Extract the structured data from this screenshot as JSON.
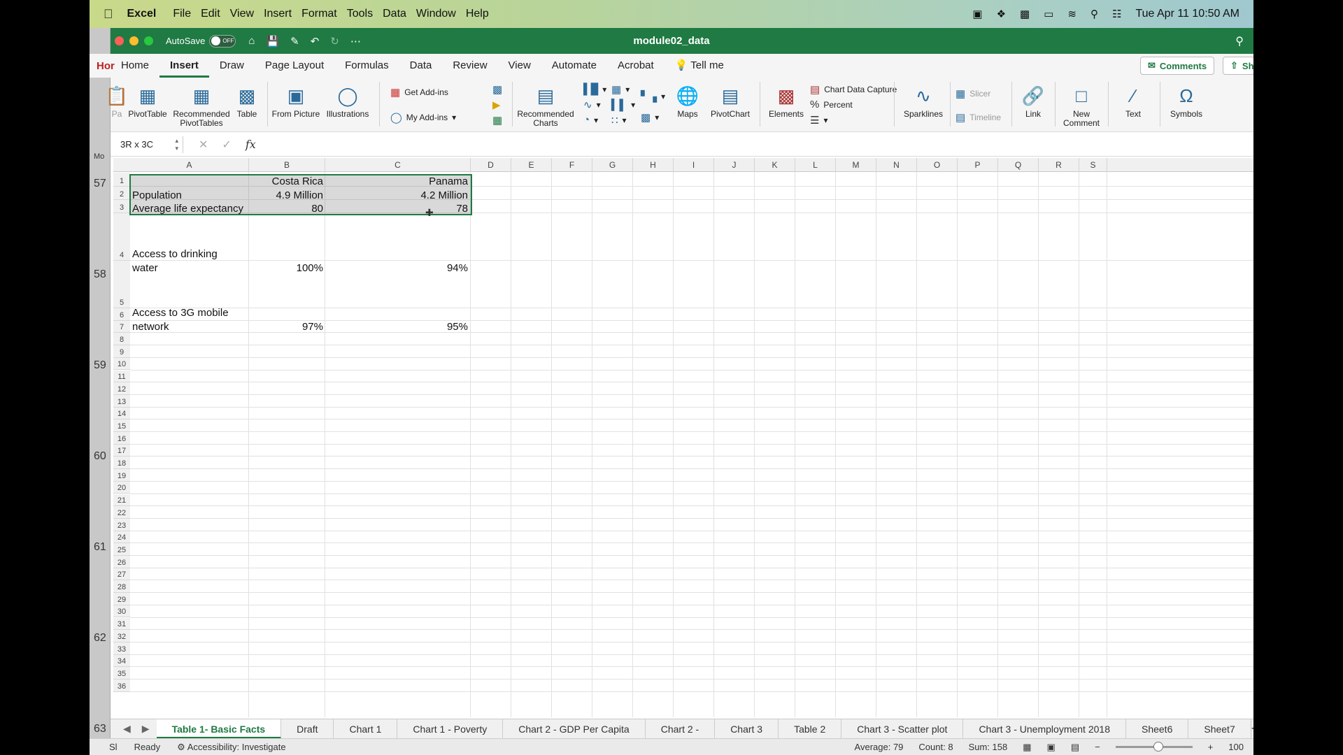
{
  "menubar": {
    "app": "Excel",
    "items": [
      "File",
      "Edit",
      "View",
      "Insert",
      "Format",
      "Tools",
      "Data",
      "Window",
      "Help"
    ],
    "datetime": "Tue Apr 11  10:50 AM"
  },
  "titlebar": {
    "autosave_label": "AutoSave",
    "autosave_state": "OFF",
    "document": "module02_data"
  },
  "ribbon_tabs": {
    "partial": "Hor",
    "items": [
      "Home",
      "Insert",
      "Draw",
      "Page Layout",
      "Formulas",
      "Data",
      "Review",
      "View",
      "Automate",
      "Acrobat"
    ],
    "active": "Insert",
    "tell_me": "Tell me",
    "comments": "Comments",
    "share_partial": "Sh"
  },
  "ribbon": {
    "paste_partial": "Pa",
    "pivot_table": "PivotTable",
    "recommended_pivot": "Recommended PivotTables",
    "table": "Table",
    "from_picture": "From Picture",
    "illustrations": "Illustrations",
    "get_addins": "Get Add-ins",
    "my_addins": "My Add-ins",
    "recommended_charts": "Recommended Charts",
    "maps": "Maps",
    "pivot_chart": "PivotChart",
    "elements": "Elements",
    "chart_data_capture": "Chart Data Capture",
    "percent": "Percent",
    "sparklines": "Sparklines",
    "slicer": "Slicer",
    "timeline": "Timeline",
    "link": "Link",
    "new_comment": "New Comment",
    "text": "Text",
    "symbols": "Symbols"
  },
  "formula_bar": {
    "name_box": "3R x 3C",
    "fx": "fx",
    "content": ""
  },
  "outer_rows": [
    "57",
    "58",
    "59",
    "60",
    "61",
    "62",
    "63"
  ],
  "outer_label_mo": "Mo",
  "columns": [
    "A",
    "B",
    "C",
    "D",
    "E",
    "F",
    "G",
    "H",
    "I",
    "J",
    "K",
    "L",
    "M",
    "N",
    "O",
    "P",
    "Q",
    "R",
    "S"
  ],
  "rows": [
    "1",
    "2",
    "3",
    "4",
    "5",
    "6",
    "7",
    "8",
    "9",
    "10",
    "11",
    "12",
    "13",
    "14",
    "15",
    "16",
    "17",
    "18",
    "19",
    "20",
    "21",
    "22",
    "23",
    "24",
    "25",
    "26",
    "27",
    "28",
    "29",
    "30",
    "31",
    "32",
    "33",
    "34",
    "35",
    "36"
  ],
  "cells": {
    "B1": "Costa Rica",
    "C1": "Panama",
    "A2": "Population",
    "B2": "4.9 Million",
    "C2": "4.2 Million",
    "A3": "Average life expectancy",
    "B3": "80",
    "C3": "78",
    "A4_line1": "Access to drinking",
    "A4_line2": "water",
    "B4": "100%",
    "C4": "94%",
    "A5_line1": "Access to 3G mobile",
    "A5_line2": "network",
    "B5": "97%",
    "C5": "95%"
  },
  "sheet_tabs": [
    "Table 1- Basic Facts",
    "Draft",
    "Chart 1",
    "Chart 1 - Poverty",
    "Chart 2 - GDP Per Capita",
    "Chart 2 -",
    "Chart 3",
    "Table 2",
    "Chart 3 - Scatter plot",
    "Chart 3 - Unemployment 2018",
    "Sheet6",
    "Sheet7"
  ],
  "active_sheet": "Table 1- Basic Facts",
  "status": {
    "partial": "Sl",
    "ready": "Ready",
    "accessibility": "Accessibility: Investigate",
    "average": "Average: 79",
    "count": "Count: 8",
    "sum": "Sum: 158",
    "zoom": "100"
  },
  "colors": {
    "excel_green": "#1f7a43",
    "selection": "#1f7a43"
  }
}
